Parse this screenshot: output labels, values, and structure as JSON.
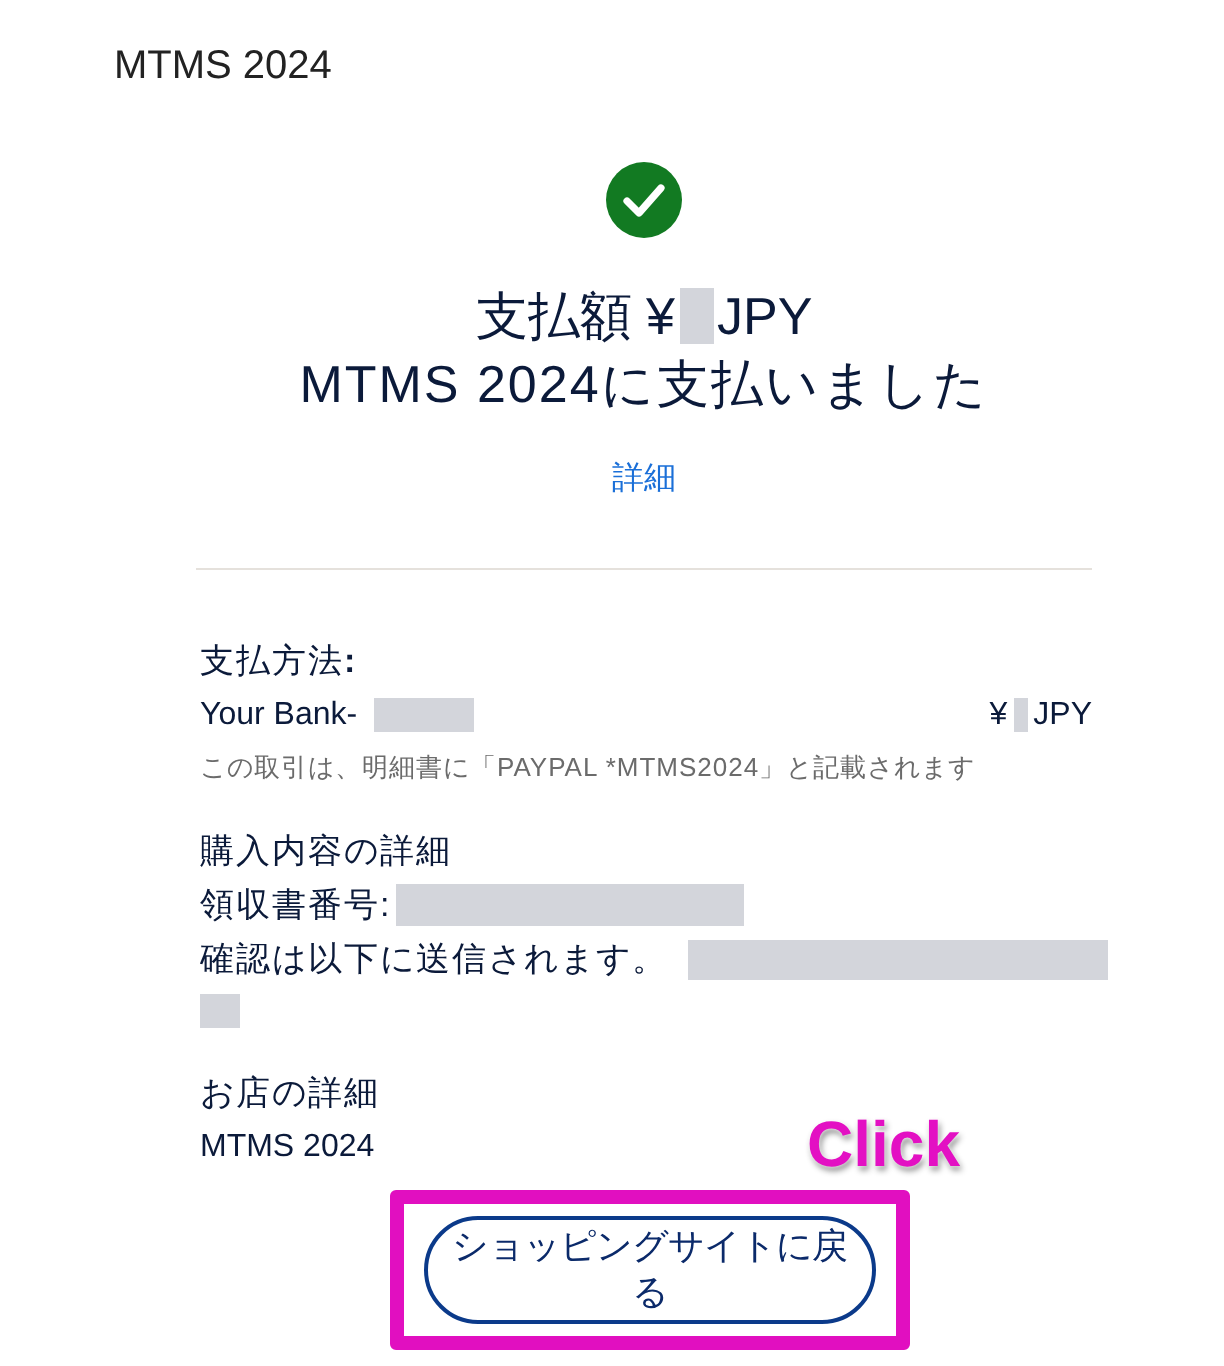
{
  "store_name": "MTMS 2024",
  "heading": {
    "amount_label": "支払額 ¥",
    "currency": "JPY",
    "message": "MTMS 2024に支払いました"
  },
  "details_link": "詳細",
  "payment_method": {
    "label": "支払方法**:**",
    "source": "Your Bank-",
    "amount_prefix": "¥",
    "currency": "JPY",
    "statement_note": "この取引は、明細書に「PAYPAL *MTMS2024」と記載されます"
  },
  "purchase_details": {
    "title": "購入内容の詳細",
    "receipt_label": "領収書番号:",
    "confirmation_text": "確認は以下に送信されます。"
  },
  "merchant": {
    "title": "お店の詳細",
    "name": "MTMS 2024"
  },
  "return_button": {
    "label": "ショッピングサイトに戻る",
    "highlighted": true
  },
  "annotation": {
    "text": "Click"
  }
}
